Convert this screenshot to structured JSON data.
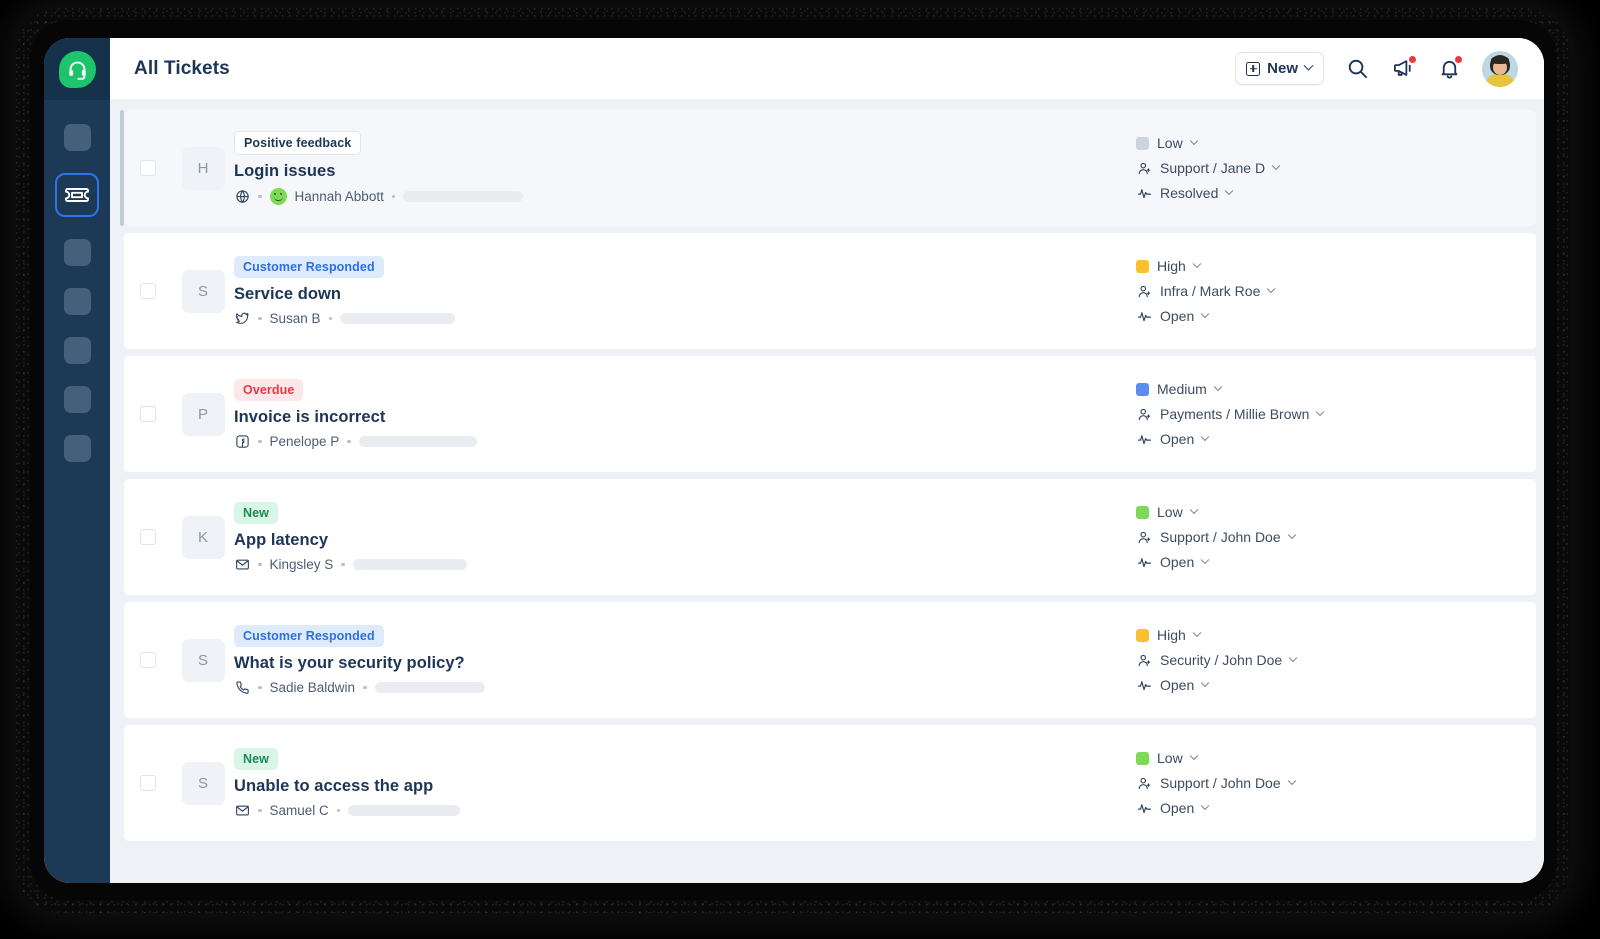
{
  "app": {
    "logo_icon": "headset-icon"
  },
  "sidebar": {
    "items": [
      {
        "icon": "placeholder-icon",
        "active": false
      },
      {
        "icon": "ticket-icon",
        "active": true
      },
      {
        "icon": "placeholder-icon",
        "active": false
      },
      {
        "icon": "placeholder-icon",
        "active": false
      },
      {
        "icon": "placeholder-icon",
        "active": false
      },
      {
        "icon": "placeholder-icon",
        "active": false
      },
      {
        "icon": "placeholder-icon",
        "active": false
      }
    ]
  },
  "header": {
    "title": "All Tickets",
    "new_button": {
      "label": "New",
      "icon": "plus-square-icon",
      "chevron": "chevron-down-icon"
    },
    "search_icon": "search-icon",
    "announcements_icon": "megaphone-icon",
    "announcements_has_badge": true,
    "notifications_icon": "bell-icon",
    "notifications_has_badge": true,
    "avatar": "user-avatar"
  },
  "colors": {
    "sidebar_bg": "#1c3a55",
    "logo_green": "#1ec46c",
    "active_border": "#2f74e8",
    "page_bg": "#eef1f6",
    "title_navy": "#1d3557",
    "priority_low_gray": "#ccd4e0",
    "priority_low_green": "#7ed957",
    "priority_medium_blue": "#5b8def",
    "priority_high_yellow": "#fbc02d",
    "badge_blue_bg": "#ddebfd",
    "badge_blue_text": "#2f6fe0",
    "badge_red_bg": "#fde8e9",
    "badge_red_text": "#e63946",
    "badge_green_bg": "#d9f5e6",
    "badge_green_text": "#1c8a53",
    "dot_red": "#f2363c"
  },
  "tickets": [
    {
      "selected": true,
      "checked": false,
      "initial": "H",
      "badge": {
        "label": "Positive feedback",
        "style": "neutral"
      },
      "subject": "Login issues",
      "channel_icon": "globe-icon",
      "has_smiley": true,
      "author": "Hannah Abbott",
      "skeleton_width": 120,
      "priority": {
        "label": "Low",
        "color": "#ccd4e0"
      },
      "assignee": {
        "label": "Support / Jane D",
        "icon": "assignee-icon"
      },
      "status": {
        "label": "Resolved",
        "icon": "activity-icon"
      }
    },
    {
      "selected": false,
      "checked": false,
      "initial": "S",
      "badge": {
        "label": "Customer Responded",
        "style": "blue"
      },
      "subject": "Service down",
      "channel_icon": "twitter-icon",
      "has_smiley": false,
      "author": "Susan B",
      "skeleton_width": 115,
      "priority": {
        "label": "High",
        "color": "#fbc02d"
      },
      "assignee": {
        "label": "Infra / Mark Roe",
        "icon": "assignee-icon"
      },
      "status": {
        "label": "Open",
        "icon": "activity-icon"
      }
    },
    {
      "selected": false,
      "checked": false,
      "initial": "P",
      "badge": {
        "label": "Overdue",
        "style": "red"
      },
      "subject": "Invoice is incorrect",
      "channel_icon": "facebook-icon",
      "has_smiley": false,
      "author": "Penelope P",
      "skeleton_width": 118,
      "priority": {
        "label": "Medium",
        "color": "#5b8def"
      },
      "assignee": {
        "label": "Payments / Millie Brown",
        "icon": "assignee-icon"
      },
      "status": {
        "label": "Open",
        "icon": "activity-icon"
      }
    },
    {
      "selected": false,
      "checked": false,
      "initial": "K",
      "badge": {
        "label": "New",
        "style": "green"
      },
      "subject": "App latency",
      "channel_icon": "email-icon",
      "has_smiley": false,
      "author": "Kingsley S",
      "skeleton_width": 114,
      "priority": {
        "label": "Low",
        "color": "#7ed957"
      },
      "assignee": {
        "label": "Support / John Doe",
        "icon": "assignee-icon"
      },
      "status": {
        "label": "Open",
        "icon": "activity-icon"
      }
    },
    {
      "selected": false,
      "checked": false,
      "initial": "S",
      "badge": {
        "label": "Customer Responded",
        "style": "blue"
      },
      "subject": "What is your security policy?",
      "channel_icon": "phone-icon",
      "has_smiley": false,
      "author": "Sadie Baldwin",
      "skeleton_width": 110,
      "priority": {
        "label": "High",
        "color": "#fbc02d"
      },
      "assignee": {
        "label": "Security / John Doe",
        "icon": "assignee-icon"
      },
      "status": {
        "label": "Open",
        "icon": "activity-icon"
      }
    },
    {
      "selected": false,
      "checked": false,
      "initial": "S",
      "badge": {
        "label": "New",
        "style": "green"
      },
      "subject": "Unable to access the app",
      "channel_icon": "email-icon",
      "has_smiley": false,
      "author": "Samuel C",
      "skeleton_width": 112,
      "priority": {
        "label": "Low",
        "color": "#7ed957"
      },
      "assignee": {
        "label": "Support / John Doe",
        "icon": "assignee-icon"
      },
      "status": {
        "label": "Open",
        "icon": "activity-icon"
      }
    }
  ]
}
